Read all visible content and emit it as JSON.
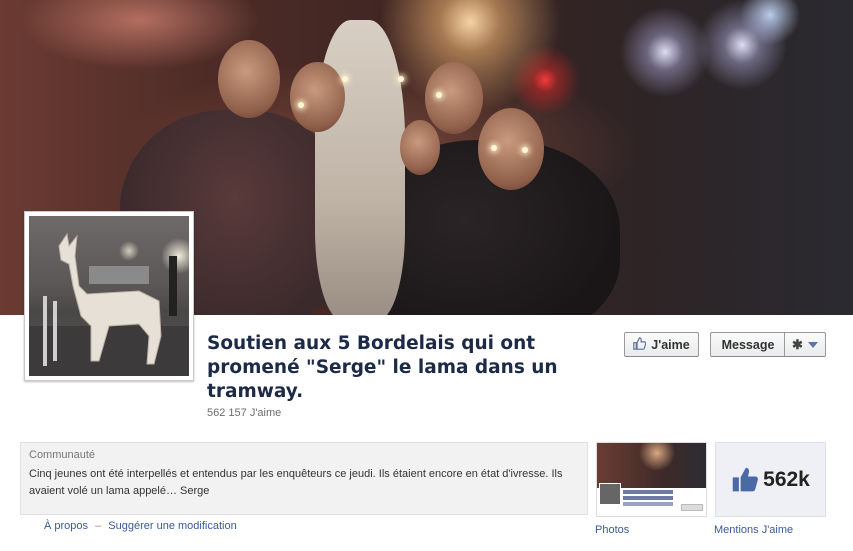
{
  "page": {
    "title": "Soutien aux 5 Bordelais qui ont promené \"Serge\" le lama dans un tramway.",
    "likes_text": "562 157 J'aime"
  },
  "buttons": {
    "like_label": "J'aime",
    "message_label": "Message",
    "like_icon": "thumbs-up-icon",
    "settings_icon": "gear-icon"
  },
  "about": {
    "category": "Communauté",
    "description": "Cinq jeunes ont été interpellés et entendus par les enquêteurs ce jeudi. Ils étaient encore en état d'ivresse. Ils avaient volé un lama appelé… Serge"
  },
  "links": {
    "about": "À propos",
    "separator": "–",
    "suggest": "Suggérer une modification"
  },
  "apps": {
    "photos_label": "Photos",
    "mentions_label": "Mentions J'aime",
    "mentions_count": "562k"
  },
  "colors": {
    "title": "#1c2a47",
    "link": "#3b5998",
    "like_blue": "#4a6aa5"
  }
}
